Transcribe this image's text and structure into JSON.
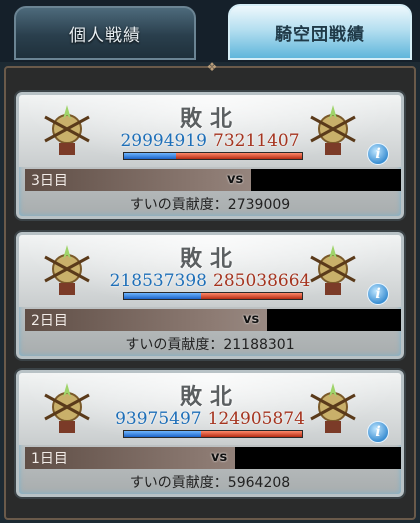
{
  "tabs": [
    {
      "label": "個人戦績",
      "active": false
    },
    {
      "label": "騎空団戦績",
      "active": true
    }
  ],
  "colors": {
    "own_score": "#1e6fb8",
    "enemy_score": "#a5341f",
    "active_tab": "#5fb6db"
  },
  "battles": [
    {
      "result": "敗北",
      "own_score": "29994919",
      "enemy_score": "73211407",
      "own_share": 0.29,
      "day": "3日目",
      "vs": "vs",
      "contribution": "すいの貢献度：2739009",
      "info_icon": "info-icon"
    },
    {
      "result": "敗北",
      "own_score": "218537398",
      "enemy_score": "285038664",
      "own_share": 0.43,
      "day": "2日目",
      "vs": "vs",
      "contribution": "すいの貢献度：21188301",
      "info_icon": "info-icon"
    },
    {
      "result": "敗北",
      "own_score": "93975497",
      "enemy_score": "124905874",
      "own_share": 0.43,
      "day": "1日目",
      "vs": "vs",
      "contribution": "すいの貢献度：5964208",
      "info_icon": "info-icon"
    }
  ]
}
